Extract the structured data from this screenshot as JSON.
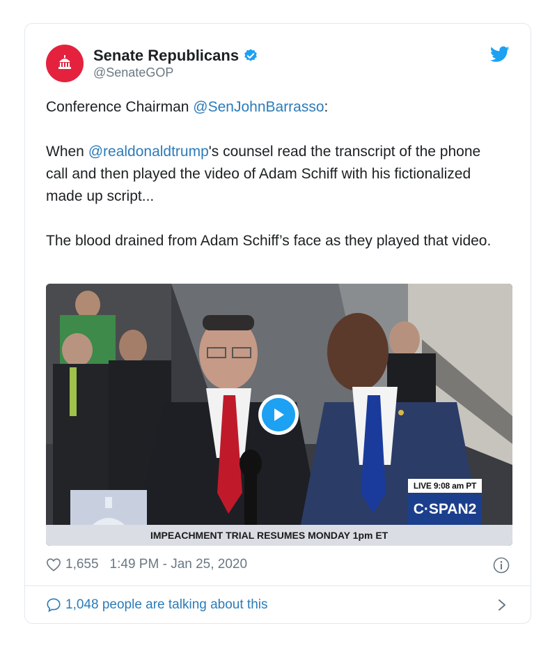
{
  "author": {
    "display_name": "Senate Republicans",
    "handle": "@SenateGOP",
    "brand_color": "#e4223d"
  },
  "tweet": {
    "line1_prefix": "Conference Chairman ",
    "line1_mention": "@SenJohnBarrasso",
    "line1_suffix": ":",
    "para2_prefix": "When ",
    "para2_mention": "@realdonaldtrump",
    "para2_suffix": "'s counsel read the transcript of the phone call and then played the video of Adam Schiff with his fictionalized made up script...",
    "para3": "The blood drained from Adam Schiff’s face as they played that video."
  },
  "media": {
    "live_label": "LIVE  9:08 am PT",
    "network_label": "C·SPAN2",
    "ticker": "IMPEACHMENT TRIAL RESUMES MONDAY 1pm ET",
    "play_icon": "play-icon"
  },
  "meta": {
    "likes": "1,655",
    "timestamp": "1:49 PM - Jan 25, 2020"
  },
  "footer": {
    "talking": "1,048 people are talking about this"
  },
  "colors": {
    "link": "#2b7bb9",
    "muted": "#697882",
    "twitter_blue": "#1da1f2",
    "cspan_blue": "#1b3f8c"
  }
}
